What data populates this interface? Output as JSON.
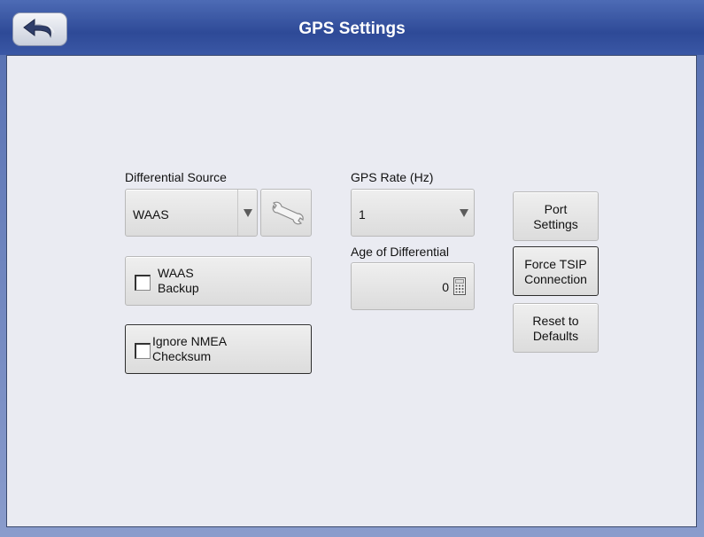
{
  "window": {
    "title": "GPS Settings"
  },
  "differential_source": {
    "label": "Differential Source",
    "value": "WAAS"
  },
  "gps_rate": {
    "label": "GPS Rate (Hz)",
    "value": "1"
  },
  "age_of_differential": {
    "label": "Age of Differential",
    "value": "0"
  },
  "waas_backup": {
    "line1": "WAAS",
    "line2": "Backup",
    "checked": false
  },
  "ignore_nmea": {
    "line1": "Ignore NMEA",
    "line2": "Checksum",
    "checked": false
  },
  "port_settings": {
    "line1": "Port",
    "line2": "Settings"
  },
  "force_tsip": {
    "line1": "Force TSIP",
    "line2": "Connection"
  },
  "reset_defaults": {
    "line1": "Reset to",
    "line2": "Defaults"
  },
  "icons": {
    "back": "back-arrow-icon",
    "wrench": "wrench-icon",
    "calculator": "calculator-icon",
    "dropdown": "dropdown-arrow-icon"
  }
}
